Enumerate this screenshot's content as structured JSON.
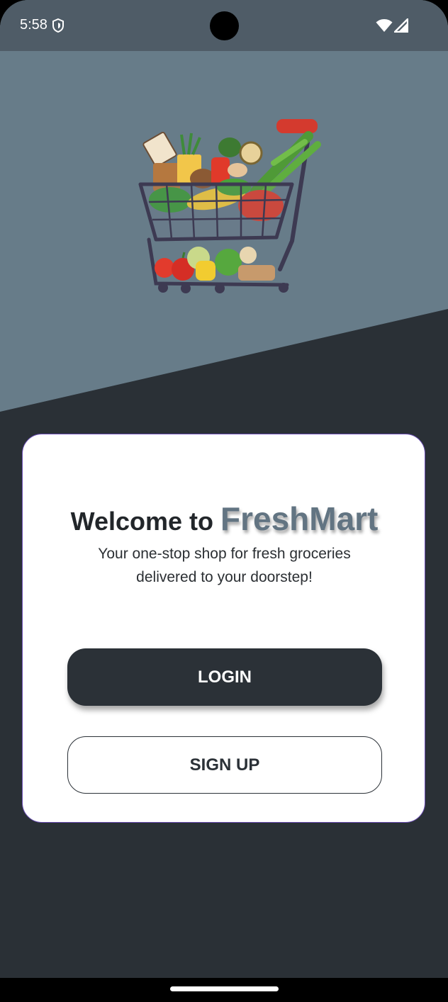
{
  "status_bar": {
    "time": "5:58",
    "icons": [
      "shield-icon",
      "wifi-icon",
      "signal-icon"
    ]
  },
  "hero": {
    "image": "shopping-cart-with-groceries-illustration"
  },
  "card": {
    "welcome_text": "Welcome to",
    "brand_name": "FreshMart",
    "tagline_line1": "Your one-stop shop for fresh groceries",
    "tagline_line2": "delivered to your doorstep!",
    "login_label": "LOGIN",
    "signup_label": "SIGN UP"
  },
  "colors": {
    "hero_bg": "#677c89",
    "dark_bg": "#2a3036",
    "brand_text": "#627482",
    "button_dark": "#2b3137",
    "card_border": "#6b4fb4"
  }
}
